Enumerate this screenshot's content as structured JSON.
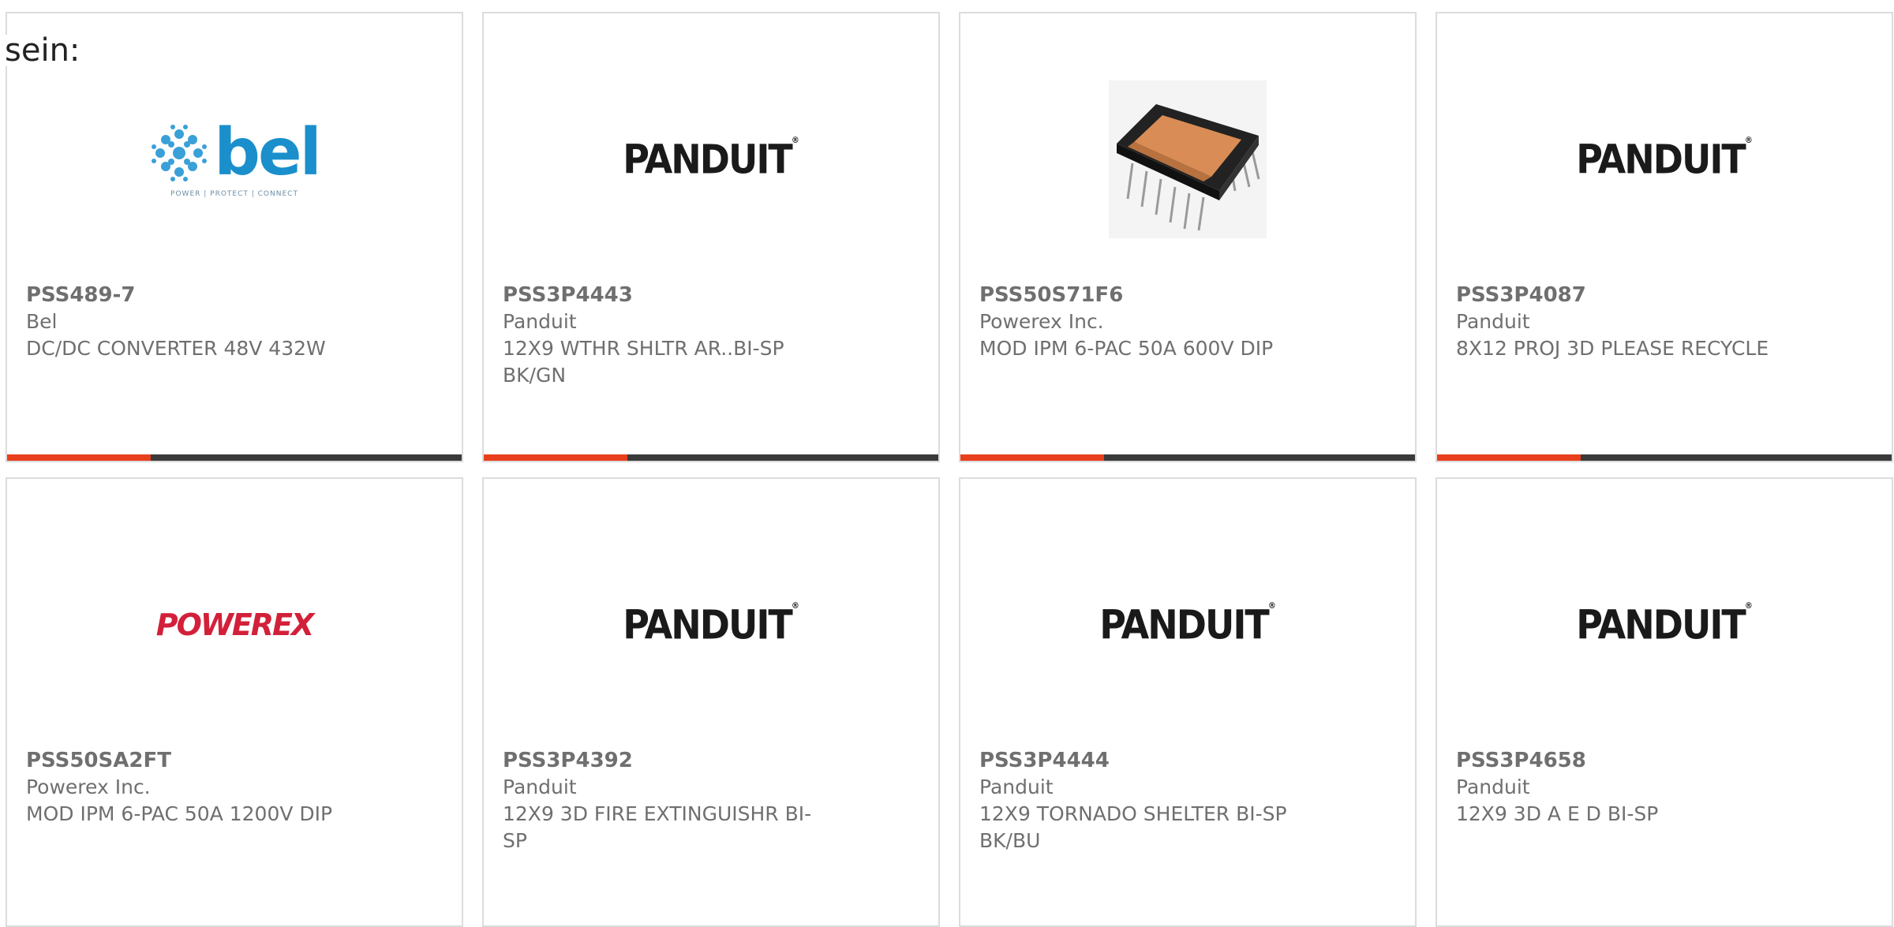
{
  "heading": "sein:",
  "colors": {
    "accent": "#e8401c",
    "bar": "#3a3a3a",
    "panduit": "#1a1a1a",
    "powerex": "#d3203a",
    "bel": "#1a8fcc"
  },
  "products": [
    {
      "logo": "bel-logo",
      "logo_text": "bel",
      "logo_tagline": "POWER | PROTECT | CONNECT",
      "part": "PSS489-7",
      "maker": "Bel",
      "desc": [
        "DC/DC CONVERTER 48V 432W"
      ]
    },
    {
      "logo": "panduit-logo",
      "logo_text": "PANDUIT",
      "part": "PSS3P4443",
      "maker": "Panduit",
      "desc": [
        "12X9 WTHR SHLTR AR..BI-SP",
        "BK/GN"
      ]
    },
    {
      "logo": "ipm-module-photo",
      "part": "PSS50S71F6",
      "maker": "Powerex Inc.",
      "desc": [
        "MOD IPM 6-PAC 50A 600V DIP"
      ]
    },
    {
      "logo": "panduit-logo",
      "logo_text": "PANDUIT",
      "part": "PSS3P4087",
      "maker": "Panduit",
      "desc": [
        "8X12 PROJ 3D PLEASE RECYCLE"
      ]
    },
    {
      "logo": "powerex-logo",
      "logo_text": "POWEREX",
      "part": "PSS50SA2FT",
      "maker": "Powerex Inc.",
      "desc": [
        "MOD IPM 6-PAC 50A 1200V DIP"
      ]
    },
    {
      "logo": "panduit-logo",
      "logo_text": "PANDUIT",
      "part": "PSS3P4392",
      "maker": "Panduit",
      "desc": [
        "12X9 3D FIRE EXTINGUISHR BI-",
        "SP"
      ]
    },
    {
      "logo": "panduit-logo",
      "logo_text": "PANDUIT",
      "part": "PSS3P4444",
      "maker": "Panduit",
      "desc": [
        "12X9 TORNADO SHELTER BI-SP",
        "BK/BU"
      ]
    },
    {
      "logo": "panduit-logo",
      "logo_text": "PANDUIT",
      "part": "PSS3P4658",
      "maker": "Panduit",
      "desc": [
        "12X9 3D A E D BI-SP"
      ]
    }
  ]
}
